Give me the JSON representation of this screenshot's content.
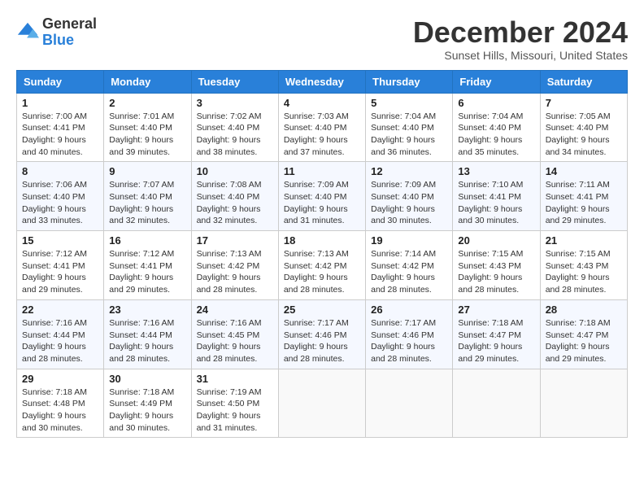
{
  "logo": {
    "general": "General",
    "blue": "Blue"
  },
  "header": {
    "title": "December 2024",
    "subtitle": "Sunset Hills, Missouri, United States"
  },
  "weekdays": [
    "Sunday",
    "Monday",
    "Tuesday",
    "Wednesday",
    "Thursday",
    "Friday",
    "Saturday"
  ],
  "weeks": [
    [
      {
        "day": "1",
        "sunrise": "7:00 AM",
        "sunset": "4:41 PM",
        "daylight": "9 hours and 40 minutes."
      },
      {
        "day": "2",
        "sunrise": "7:01 AM",
        "sunset": "4:40 PM",
        "daylight": "9 hours and 39 minutes."
      },
      {
        "day": "3",
        "sunrise": "7:02 AM",
        "sunset": "4:40 PM",
        "daylight": "9 hours and 38 minutes."
      },
      {
        "day": "4",
        "sunrise": "7:03 AM",
        "sunset": "4:40 PM",
        "daylight": "9 hours and 37 minutes."
      },
      {
        "day": "5",
        "sunrise": "7:04 AM",
        "sunset": "4:40 PM",
        "daylight": "9 hours and 36 minutes."
      },
      {
        "day": "6",
        "sunrise": "7:04 AM",
        "sunset": "4:40 PM",
        "daylight": "9 hours and 35 minutes."
      },
      {
        "day": "7",
        "sunrise": "7:05 AM",
        "sunset": "4:40 PM",
        "daylight": "9 hours and 34 minutes."
      }
    ],
    [
      {
        "day": "8",
        "sunrise": "7:06 AM",
        "sunset": "4:40 PM",
        "daylight": "9 hours and 33 minutes."
      },
      {
        "day": "9",
        "sunrise": "7:07 AM",
        "sunset": "4:40 PM",
        "daylight": "9 hours and 32 minutes."
      },
      {
        "day": "10",
        "sunrise": "7:08 AM",
        "sunset": "4:40 PM",
        "daylight": "9 hours and 32 minutes."
      },
      {
        "day": "11",
        "sunrise": "7:09 AM",
        "sunset": "4:40 PM",
        "daylight": "9 hours and 31 minutes."
      },
      {
        "day": "12",
        "sunrise": "7:09 AM",
        "sunset": "4:40 PM",
        "daylight": "9 hours and 30 minutes."
      },
      {
        "day": "13",
        "sunrise": "7:10 AM",
        "sunset": "4:41 PM",
        "daylight": "9 hours and 30 minutes."
      },
      {
        "day": "14",
        "sunrise": "7:11 AM",
        "sunset": "4:41 PM",
        "daylight": "9 hours and 29 minutes."
      }
    ],
    [
      {
        "day": "15",
        "sunrise": "7:12 AM",
        "sunset": "4:41 PM",
        "daylight": "9 hours and 29 minutes."
      },
      {
        "day": "16",
        "sunrise": "7:12 AM",
        "sunset": "4:41 PM",
        "daylight": "9 hours and 29 minutes."
      },
      {
        "day": "17",
        "sunrise": "7:13 AM",
        "sunset": "4:42 PM",
        "daylight": "9 hours and 28 minutes."
      },
      {
        "day": "18",
        "sunrise": "7:13 AM",
        "sunset": "4:42 PM",
        "daylight": "9 hours and 28 minutes."
      },
      {
        "day": "19",
        "sunrise": "7:14 AM",
        "sunset": "4:42 PM",
        "daylight": "9 hours and 28 minutes."
      },
      {
        "day": "20",
        "sunrise": "7:15 AM",
        "sunset": "4:43 PM",
        "daylight": "9 hours and 28 minutes."
      },
      {
        "day": "21",
        "sunrise": "7:15 AM",
        "sunset": "4:43 PM",
        "daylight": "9 hours and 28 minutes."
      }
    ],
    [
      {
        "day": "22",
        "sunrise": "7:16 AM",
        "sunset": "4:44 PM",
        "daylight": "9 hours and 28 minutes."
      },
      {
        "day": "23",
        "sunrise": "7:16 AM",
        "sunset": "4:44 PM",
        "daylight": "9 hours and 28 minutes."
      },
      {
        "day": "24",
        "sunrise": "7:16 AM",
        "sunset": "4:45 PM",
        "daylight": "9 hours and 28 minutes."
      },
      {
        "day": "25",
        "sunrise": "7:17 AM",
        "sunset": "4:46 PM",
        "daylight": "9 hours and 28 minutes."
      },
      {
        "day": "26",
        "sunrise": "7:17 AM",
        "sunset": "4:46 PM",
        "daylight": "9 hours and 28 minutes."
      },
      {
        "day": "27",
        "sunrise": "7:18 AM",
        "sunset": "4:47 PM",
        "daylight": "9 hours and 29 minutes."
      },
      {
        "day": "28",
        "sunrise": "7:18 AM",
        "sunset": "4:47 PM",
        "daylight": "9 hours and 29 minutes."
      }
    ],
    [
      {
        "day": "29",
        "sunrise": "7:18 AM",
        "sunset": "4:48 PM",
        "daylight": "9 hours and 30 minutes."
      },
      {
        "day": "30",
        "sunrise": "7:18 AM",
        "sunset": "4:49 PM",
        "daylight": "9 hours and 30 minutes."
      },
      {
        "day": "31",
        "sunrise": "7:19 AM",
        "sunset": "4:50 PM",
        "daylight": "9 hours and 31 minutes."
      },
      null,
      null,
      null,
      null
    ]
  ],
  "labels": {
    "sunrise": "Sunrise:",
    "sunset": "Sunset:",
    "daylight": "Daylight:"
  }
}
